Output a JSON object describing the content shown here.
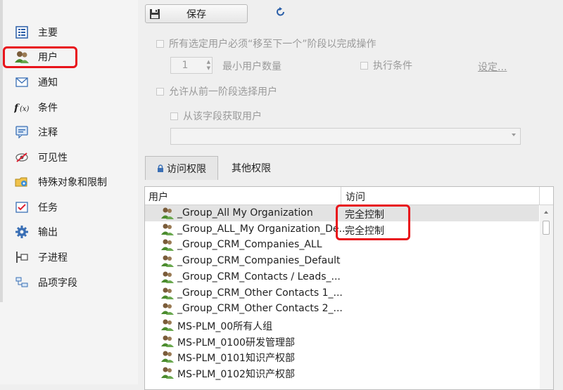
{
  "sidebar": {
    "items": [
      {
        "label": "主要",
        "icon": "list-icon"
      },
      {
        "label": "用户",
        "icon": "users-icon"
      },
      {
        "label": "通知",
        "icon": "envelope-icon"
      },
      {
        "label": "条件",
        "icon": "function-icon"
      },
      {
        "label": "注释",
        "icon": "comment-icon"
      },
      {
        "label": "可见性",
        "icon": "eye-hidden-icon"
      },
      {
        "label": "特殊对象和限制",
        "icon": "special-objects-icon"
      },
      {
        "label": "任务",
        "icon": "task-icon"
      },
      {
        "label": "输出",
        "icon": "gear-icon"
      },
      {
        "label": "子进程",
        "icon": "subprocess-icon"
      },
      {
        "label": "品项字段",
        "icon": "item-fields-icon"
      }
    ]
  },
  "toolbar": {
    "save_label": "保存",
    "refresh_icon": "refresh-icon"
  },
  "options": {
    "all_must_move_label": "所有选定用户必须“移至下一个”阶段以完成操作",
    "min_users_value": "1",
    "min_users_label": "最小用户数量",
    "exec_condition_label": "执行条件",
    "set_link": "设定...",
    "allow_prev_stage_label": "允许从前一阶段选择用户",
    "from_field_label": "从该字段获取用户",
    "field_select_value": ""
  },
  "tabs": [
    {
      "label": "访问权限",
      "active": true
    },
    {
      "label": "其他权限",
      "active": false
    }
  ],
  "grid": {
    "columns": [
      "用户",
      "访问"
    ],
    "rows": [
      {
        "user": "_Group_All My Organization",
        "access": "完全控制"
      },
      {
        "user": "_Group_ALL_My Organization_De...",
        "access": "完全控制"
      },
      {
        "user": "_Group_CRM_Companies_ALL",
        "access": ""
      },
      {
        "user": "_Group_CRM_Companies_Default",
        "access": ""
      },
      {
        "user": "_Group_CRM_Contacts / Leads_...",
        "access": ""
      },
      {
        "user": "_Group_CRM_Other Contacts 1_...",
        "access": ""
      },
      {
        "user": "_Group_CRM_Other Contacts 2_...",
        "access": ""
      },
      {
        "user": "MS-PLM_00所有人组",
        "access": ""
      },
      {
        "user": "MS-PLM_0100研发管理部",
        "access": ""
      },
      {
        "user": "MS-PLM_0101知识产权部",
        "access": ""
      },
      {
        "user": "MS-PLM_0102知识产权部",
        "access": ""
      }
    ]
  },
  "colors": {
    "highlight_red": "#e8141b",
    "selected_row": "#e3e3e3"
  }
}
